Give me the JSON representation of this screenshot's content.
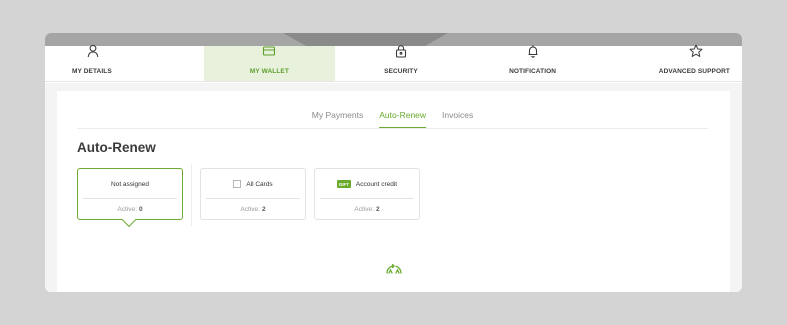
{
  "nav": {
    "items": [
      {
        "label": "MY DETAILS",
        "icon": "user-icon"
      },
      {
        "label": "MY WALLET",
        "icon": "wallet-icon"
      },
      {
        "label": "SECURITY",
        "icon": "lock-icon"
      },
      {
        "label": "NOTIFICATION",
        "icon": "bell-icon"
      },
      {
        "label": "ADVANCED SUPPORT",
        "icon": "star-icon"
      }
    ],
    "active": "MY WALLET"
  },
  "subtabs": {
    "items": [
      "My Payments",
      "Auto-Renew",
      "Invoices"
    ],
    "active": "Auto-Renew"
  },
  "heading": "Auto-Renew",
  "options": [
    {
      "title": "Not assigned",
      "active_label": "Active:",
      "active_count": "0",
      "selected": true
    },
    {
      "title": "All Cards",
      "active_label": "Active:",
      "active_count": "2",
      "icon": "checkbox-icon"
    },
    {
      "title": "Account credit",
      "active_label": "Active:",
      "active_count": "2",
      "icon": "gift-card-icon",
      "badge": "GIFT"
    }
  ],
  "colors": {
    "accent": "#6aab2f",
    "active_nav_bg": "#e7f1dc",
    "backdrop": "#d4d4d4"
  }
}
